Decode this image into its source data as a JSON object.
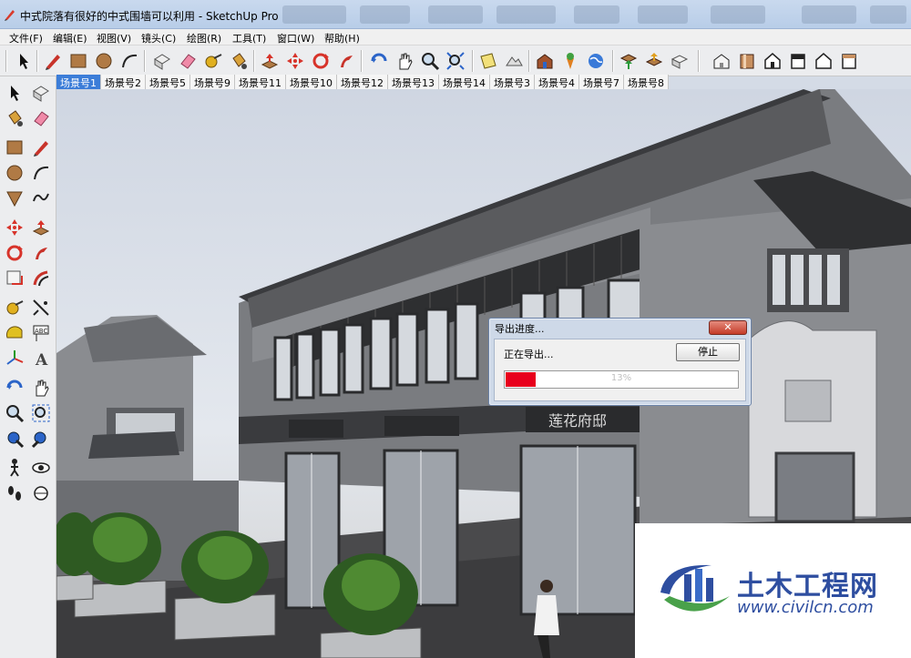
{
  "window": {
    "title": "中式院落有很好的中式围墙可以利用 - SketchUp Pro"
  },
  "menu": [
    "文件(F)",
    "编辑(E)",
    "视图(V)",
    "镜头(C)",
    "绘图(R)",
    "工具(T)",
    "窗口(W)",
    "帮助(H)"
  ],
  "top_tools": [
    "select-icon",
    "pencil-icon",
    "rectangle-icon",
    "circle-icon",
    "arc-icon",
    "eraser-box-icon",
    "eraser-icon",
    "tape-icon",
    "paint-bucket-icon",
    "push-pull-icon",
    "move-icon",
    "rotate-icon",
    "follow-me-icon",
    "orbit-icon",
    "pan-icon",
    "zoom-icon",
    "zoom-extents-icon",
    "add-location-icon",
    "terrain-icon",
    "warehouse-icon",
    "pin-icon",
    "earth-icon",
    "import-icon",
    "export-icon",
    "3d-text-icon",
    "iso-view-icon",
    "front-view-icon",
    "right-view-icon",
    "back-view-icon",
    "left-view-icon",
    "top-view-icon"
  ],
  "scene_tabs": [
    "场景号1",
    "场景号2",
    "场景号5",
    "场景号9",
    "场景号11",
    "场景号10",
    "场景号12",
    "场景号13",
    "场景号14",
    "场景号3",
    "场景号4",
    "场景号7",
    "场景号8"
  ],
  "active_scene": 0,
  "left_tools": [
    "select-icon",
    "component-icon",
    "paint-bucket-icon",
    "eraser-icon",
    "rectangle-icon",
    "pencil-icon",
    "circle-icon",
    "arc-icon",
    "polygon-icon",
    "freehand-icon",
    "move-icon",
    "push-pull-icon",
    "rotate-icon",
    "follow-me-icon",
    "scale-icon",
    "offset-icon",
    "tape-icon",
    "dimension-icon",
    "protractor-icon",
    "text-icon",
    "axes-icon",
    "3d-text-icon",
    "orbit-icon",
    "pan-icon",
    "zoom-icon",
    "zoom-window-icon",
    "previous-view-icon",
    "zoom-extents-icon",
    "walk-icon",
    "look-around-icon",
    "footprint-icon",
    "section-icon"
  ],
  "dialog": {
    "title": "导出进度...",
    "close_label": "✕",
    "status": "正在导出...",
    "stop_label": "停止",
    "progress_percent": 13,
    "progress_text": "13%"
  },
  "scene": {
    "shop_sign": "莲花府邸"
  },
  "watermark": {
    "title": "土木工程网",
    "url": "www.civilcn.com"
  },
  "colors": {
    "accent": "#3c7dd8",
    "progress": "#e8001c",
    "watermark": "#2e4ea0"
  }
}
